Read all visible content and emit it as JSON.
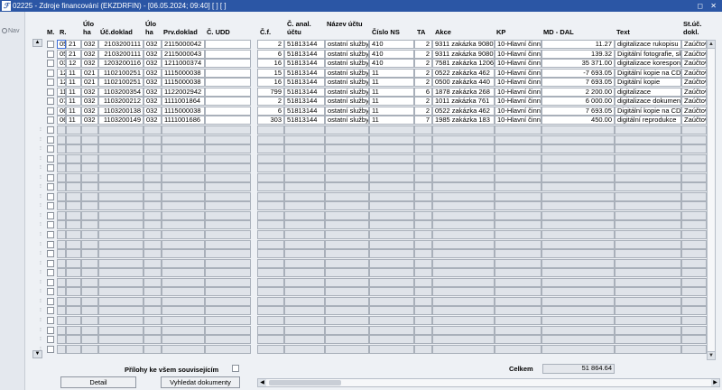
{
  "window": {
    "title": "02225 - Zdroje financování (EKZDRFIN) - [06.05.2024; 09:40]  [ ]  [ ]",
    "logo": "ℱ",
    "controls": "◻ ✕"
  },
  "sidebar": {
    "nav_label": "Nav"
  },
  "columns": {
    "m": "M.",
    "r": "R.",
    "uloha": "Úlo\nha",
    "ucdoklad": "Úč.doklad",
    "uloha2": "Úlo\nha",
    "prvdoklad": "Prv.doklad",
    "cudd": "Č. UDD",
    "cf": "Č.f.",
    "canal": "Č. anal.\núčtu",
    "nazev": "Název účtu",
    "cislons": "Číslo NS",
    "ta": "TA",
    "akce": "Akce",
    "kp": "KP",
    "mddal": "MD - DAL",
    "text": "Text",
    "stuc": "St.úč.\ndokl."
  },
  "rows": [
    {
      "m": "05",
      "r": "21",
      "uloha": "032",
      "ucdoklad": "2103200111",
      "uloha2": "032",
      "prvdoklad": "2115000042",
      "cudd": "",
      "cf": "2",
      "canal": "51813144",
      "nazev": "ostatní služby",
      "cislons": "410",
      "ta": "2",
      "akce": "9311 zakázka 9080",
      "kp": "10-Hlavní činn",
      "mddal": "11.27",
      "text": "digitalizace rukopisu",
      "stuc": "Zaúčtov"
    },
    {
      "m": "05",
      "r": "21",
      "uloha": "032",
      "ucdoklad": "2103200111",
      "uloha2": "032",
      "prvdoklad": "2115000043",
      "cudd": "",
      "cf": "6",
      "canal": "51813144",
      "nazev": "ostatní služby",
      "cislons": "410",
      "ta": "2",
      "akce": "9311 zakázka 9080",
      "kp": "10-Hlavní činn",
      "mddal": "139.32",
      "text": "Digitální fotografie, sk",
      "stuc": "Zaúčtov"
    },
    {
      "m": "03",
      "r": "12",
      "uloha": "032",
      "ucdoklad": "1203200116",
      "uloha2": "032",
      "prvdoklad": "1211000374",
      "cudd": "",
      "cf": "16",
      "canal": "51813144",
      "nazev": "ostatní služby",
      "cislons": "410",
      "ta": "2",
      "akce": "7581 zakázka 1206",
      "kp": "10-Hlavní činn",
      "mddal": "35 371.00",
      "text": "digitalizace korespond",
      "stuc": "Zaúčtov"
    },
    {
      "m": "12",
      "r": "11",
      "uloha": "021",
      "ucdoklad": "1102100251",
      "uloha2": "032",
      "prvdoklad": "1115000038",
      "cudd": "",
      "cf": "15",
      "canal": "51813144",
      "nazev": "ostatní služby",
      "cislons": "11",
      "ta": "2",
      "akce": "0522 zakázka 462",
      "kp": "10-Hlavní činn",
      "mddal": "-7 693.05",
      "text": "Digitální kopie na CD S",
      "stuc": "Zaúčtov"
    },
    {
      "m": "12",
      "r": "11",
      "uloha": "021",
      "ucdoklad": "1102100251",
      "uloha2": "032",
      "prvdoklad": "1115000038",
      "cudd": "",
      "cf": "16",
      "canal": "51813144",
      "nazev": "ostatní služby",
      "cislons": "11",
      "ta": "2",
      "akce": "0500 zakázka 440",
      "kp": "10-Hlavní činn",
      "mddal": "7 693.05",
      "text": "Digitální kopie",
      "stuc": "Zaúčtov"
    },
    {
      "m": "11",
      "r": "11",
      "uloha": "032",
      "ucdoklad": "1103200354",
      "uloha2": "032",
      "prvdoklad": "1122002942",
      "cudd": "",
      "cf": "799",
      "canal": "51813144",
      "nazev": "ostatní služby",
      "cislons": "11",
      "ta": "6",
      "akce": "1878 zakázka 268",
      "kp": "10-Hlavní činn",
      "mddal": "2 200.00",
      "text": "digitalizace",
      "stuc": "Zaúčtov"
    },
    {
      "m": "07",
      "r": "11",
      "uloha": "032",
      "ucdoklad": "1103200212",
      "uloha2": "032",
      "prvdoklad": "1111001864",
      "cudd": "",
      "cf": "2",
      "canal": "51813144",
      "nazev": "ostatní služby",
      "cislons": "11",
      "ta": "2",
      "akce": "1011 zakázka 761",
      "kp": "10-Hlavní činn",
      "mddal": "6 000.00",
      "text": "digitalizace dokument",
      "stuc": "Zaúčtov"
    },
    {
      "m": "06",
      "r": "11",
      "uloha": "032",
      "ucdoklad": "1103200138",
      "uloha2": "032",
      "prvdoklad": "1115000038",
      "cudd": "",
      "cf": "6",
      "canal": "51813144",
      "nazev": "ostatní služby",
      "cislons": "11",
      "ta": "2",
      "akce": "0522 zakázka 462",
      "kp": "10-Hlavní činn",
      "mddal": "7 693.05",
      "text": "Digitální kopie na CD S",
      "stuc": "Zaúčtov"
    },
    {
      "m": "06",
      "r": "11",
      "uloha": "032",
      "ucdoklad": "1103200149",
      "uloha2": "032",
      "prvdoklad": "1111001686",
      "cudd": "",
      "cf": "303",
      "canal": "51813144",
      "nazev": "ostatní služby",
      "cislons": "11",
      "ta": "7",
      "akce": "1985 zakázka 183",
      "kp": "10-Hlavní činn",
      "mddal": "450.00",
      "text": "digitální reprodukce",
      "stuc": "Zaúčtov"
    }
  ],
  "footer": {
    "attachments_label": "Přílohy ke všem souvisejícím",
    "total_label": "Celkem",
    "total_value": "51 864.64",
    "detail_button": "Detail",
    "find_docs_button": "Vyhledat dokumenty",
    "hscroll_arrow_left": "◀",
    "hscroll_arrow_right": "▶",
    "vscroll_up": "▲",
    "vscroll_down": "▼"
  }
}
